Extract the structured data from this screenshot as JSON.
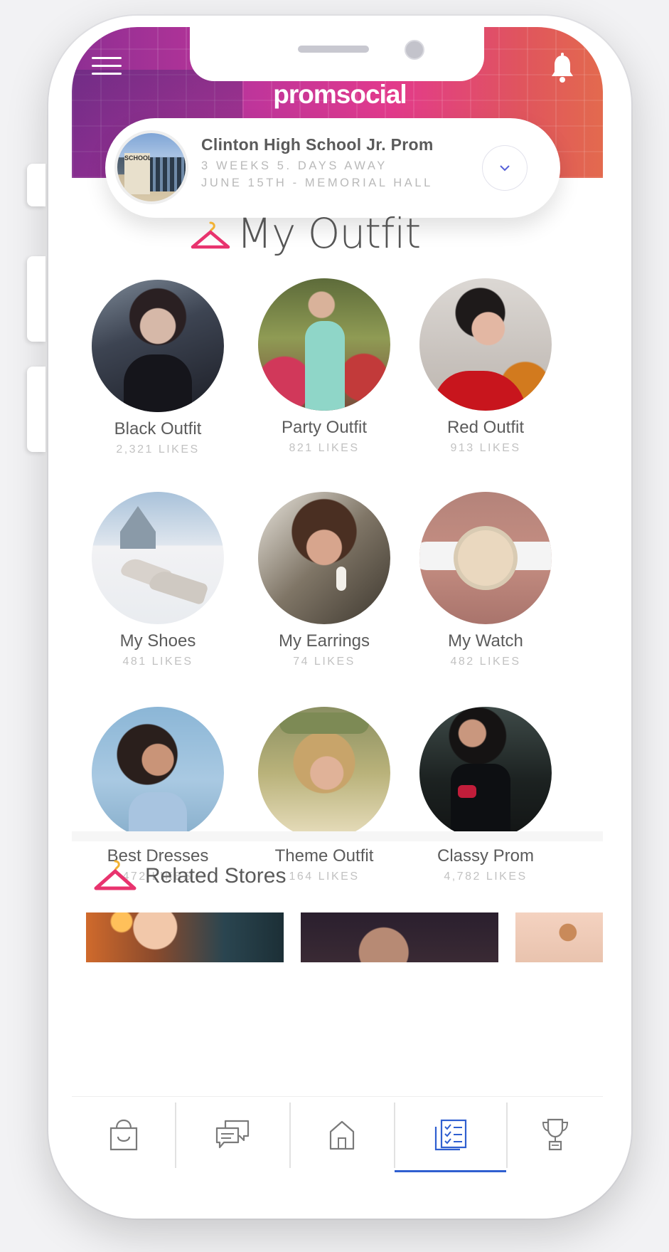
{
  "header": {
    "logo": "promsocial",
    "menu_icon": "menu-icon",
    "notifications_icon": "bell-icon"
  },
  "event": {
    "title": "Clinton High School Jr. Prom",
    "countdown": "3 WEEKS  5. DAYS AWAY",
    "date_location": "JUNE 15TH -  MEMORIAL  HALL",
    "photo_sign": "SCHOOL"
  },
  "outfit_section": {
    "title": "My Outfit",
    "items": [
      {
        "name": "Black Outfit",
        "likes": "2,321 LIKES"
      },
      {
        "name": "Party Outfit",
        "likes": "821 LIKES"
      },
      {
        "name": "Red Outfit",
        "likes": "913 LIKES"
      },
      {
        "name": "My Shoes",
        "likes": "481 LIKES"
      },
      {
        "name": "My Earrings",
        "likes": "74 LIKES"
      },
      {
        "name": "My Watch",
        "likes": "482 LIKES"
      },
      {
        "name": "Best Dresses",
        "likes": "472 LIKES"
      },
      {
        "name": "Theme Outfit",
        "likes": "164 LIKES"
      },
      {
        "name": "Classy Prom",
        "likes": "4,782 LIKES"
      }
    ]
  },
  "related": {
    "title": "Related Stores"
  },
  "tabs": [
    {
      "icon": "shopping-bag-icon"
    },
    {
      "icon": "chat-icon"
    },
    {
      "icon": "home-icon"
    },
    {
      "icon": "checklist-icon",
      "active": true
    },
    {
      "icon": "trophy-icon"
    }
  ],
  "colors": {
    "brand_pink": "#e23a8c",
    "active_tab": "#2f5fd0",
    "hanger": "#e8336e",
    "hanger_hook": "#f2b233"
  }
}
